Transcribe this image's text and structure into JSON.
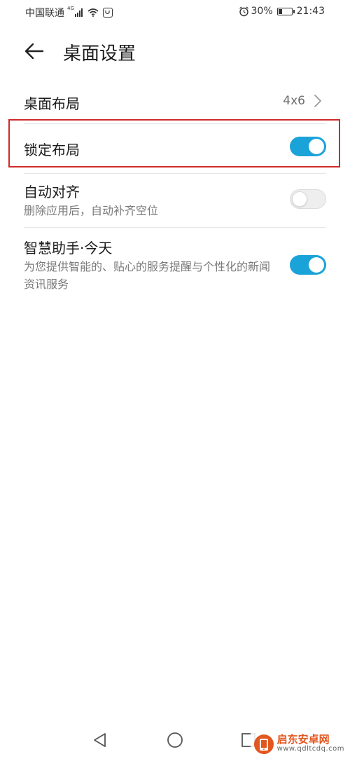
{
  "status_bar": {
    "carrier": "中国联通",
    "network": "4G",
    "battery_percent": "30%",
    "battery_level": 0.3,
    "time": "21:43"
  },
  "header": {
    "title": "桌面设置"
  },
  "settings": {
    "layout": {
      "label": "桌面布局",
      "value": "4x6"
    },
    "lock_layout": {
      "label": "锁定布局",
      "enabled": true
    },
    "auto_align": {
      "label": "自动对齐",
      "description": "删除应用后，自动补齐空位",
      "enabled": false
    },
    "smart_assistant": {
      "label": "智慧助手·今天",
      "description": "为您提供智能的、贴心的服务提醒与个性化的新闻资讯服务",
      "enabled": true
    }
  },
  "colors": {
    "accent": "#1aa3d9",
    "highlight": "#cf2a2a",
    "watermark_orange": "#e2561f"
  },
  "nav_bar": {
    "icons": [
      "triangle-back-icon",
      "circle-home-icon",
      "square-recents-icon"
    ]
  },
  "watermark": {
    "name": "启东安卓网",
    "url": "www.qdltcdq.com"
  }
}
